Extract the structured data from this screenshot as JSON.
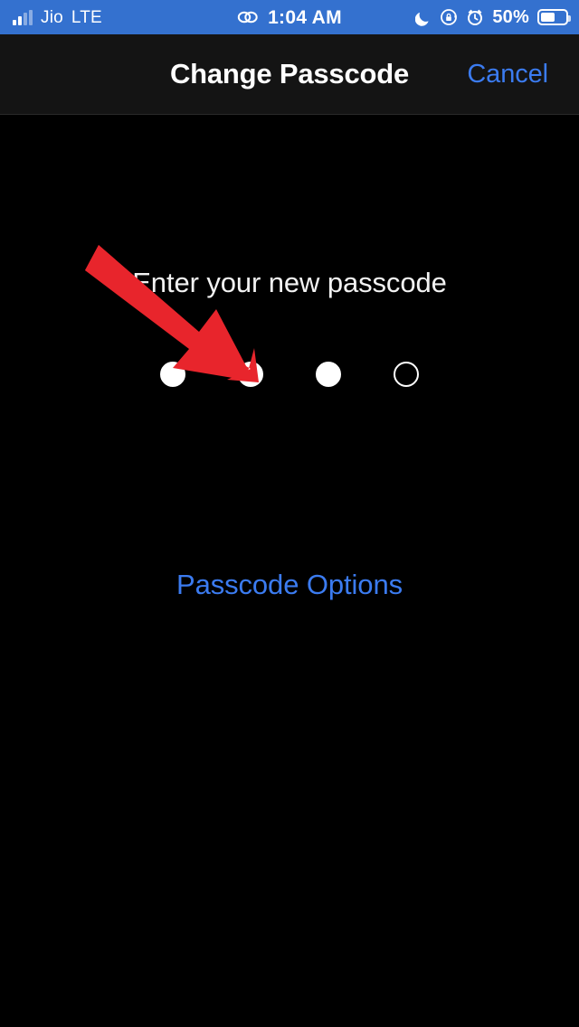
{
  "status_bar": {
    "carrier": "Jio",
    "network": "LTE",
    "signal_icon": "signal-bars-icon",
    "signal_bars_filled": 2,
    "signal_bars_total": 4,
    "link_icon": "chain-link-icon",
    "time": "1:04 AM",
    "dnd_icon": "moon-icon",
    "rotation_lock_icon": "rotation-lock-icon",
    "alarm_icon": "alarm-clock-icon",
    "battery_percent": "50%",
    "battery_level": 50,
    "battery_icon": "battery-icon",
    "background_color": "#3471cf",
    "text_color": "#ffffff"
  },
  "nav_bar": {
    "title": "Change Passcode",
    "cancel_label": "Cancel",
    "background_color": "#141414",
    "accent_color": "#3b7bf0"
  },
  "content": {
    "prompt": "Enter your new passcode",
    "passcode_options_label": "Passcode Options",
    "passcode": {
      "total_digits": 4,
      "entered_digits": 3,
      "dots": [
        "filled",
        "filled",
        "filled",
        "empty"
      ]
    },
    "background_color": "#000000"
  },
  "annotation": {
    "arrow_icon": "red-arrow-icon",
    "arrow_color": "#e8252c",
    "direction": "down-right",
    "points_to": "Enter your new passcode"
  }
}
